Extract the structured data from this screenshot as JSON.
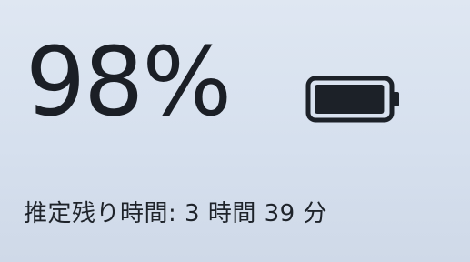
{
  "battery": {
    "percent_text": "98%",
    "level": 0.98,
    "estimate_text": "推定残り時間: 3 時間 39 分",
    "icon": "battery-icon"
  },
  "colors": {
    "background": "#d8e1ee",
    "text": "#1b1f26",
    "battery_fill": "#1c2128"
  }
}
